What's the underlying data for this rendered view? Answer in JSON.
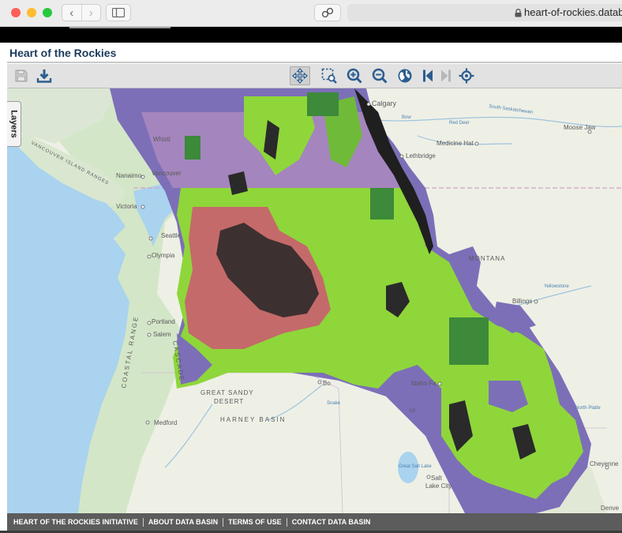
{
  "browser": {
    "url": "heart-of-rockies.databa",
    "back_glyph": "‹",
    "forward_glyph": "›"
  },
  "app": {
    "title": "Heart of the Rockies"
  },
  "toolbar": {
    "save_icon": "save-icon",
    "download_icon": "download-icon",
    "pan_icon": "pan-icon",
    "zoom_box_icon": "zoom-box-icon",
    "zoom_in_icon": "zoom-in-icon",
    "zoom_out_icon": "zoom-out-icon",
    "full_extent_icon": "globe-icon",
    "previous_extent_icon": "previous-extent-icon",
    "next_extent_icon": "next-extent-icon",
    "locate_icon": "locate-icon"
  },
  "map": {
    "layers_label": "Layers",
    "labels": {
      "calgary": "Calgary",
      "medicine_hat": "Medicine Hat",
      "lethbridge": "Lethbridge",
      "moose_jaw": "Moose Jaw",
      "whistler": "Whistl",
      "vancouver": "Vancouver",
      "nanaimo": "Nanaimo",
      "victoria": "Victoria",
      "seattle": "Seattle",
      "olympia": "Olympia",
      "portland": "Portland",
      "salem": "Salem",
      "medford": "Medford",
      "boise": "Bo",
      "idaho_falls": "Idaho Fa",
      "billings": "Billings",
      "cheyenne": "Cheyenne",
      "denver": "Denve",
      "salt_lake_city_1": "Salt",
      "salt_lake_city_2": "Lake City",
      "great_salt_lake": "Great Salt Lake",
      "montana": "MONTANA",
      "great_sandy_desert_1": "GREAT SANDY",
      "great_sandy_desert_2": "DESERT",
      "harney_basin": "HARNEY BASIN",
      "cascade": "CASCADE",
      "coastal": "COASTAL RANGE",
      "vancouver_island_ranges": "VANCOUVER ISLAND RANGES",
      "south_saskatchewan": "South Saskatchewan",
      "yellowstone": "Yellowstone",
      "north_platte": "North Platte",
      "snake": "Snake",
      "ut": "Ut",
      "bow": "Bow",
      "red_deer": "Red Deer"
    }
  },
  "footer": {
    "links": [
      "HEART OF THE ROCKIES INITIATIVE",
      "ABOUT DATA BASIN",
      "TERMS OF USE",
      "CONTACT DATA BASIN"
    ]
  },
  "colors": {
    "title": "#1b3a5c",
    "toolbar_icon": "#2c5d8f",
    "footer_bg": "#5c5c5c",
    "ocean": "#a9d3ee",
    "land": "#eef0e6",
    "forest_terrain": "#cfe3c4",
    "overlay_purple": "#7a6cb6",
    "overlay_violet": "#a080b8",
    "overlay_green": "#8fd63a",
    "overlay_dark_green": "#3c8a3a",
    "overlay_red": "#c46a6a",
    "overlay_black": "#1f1f1f"
  }
}
